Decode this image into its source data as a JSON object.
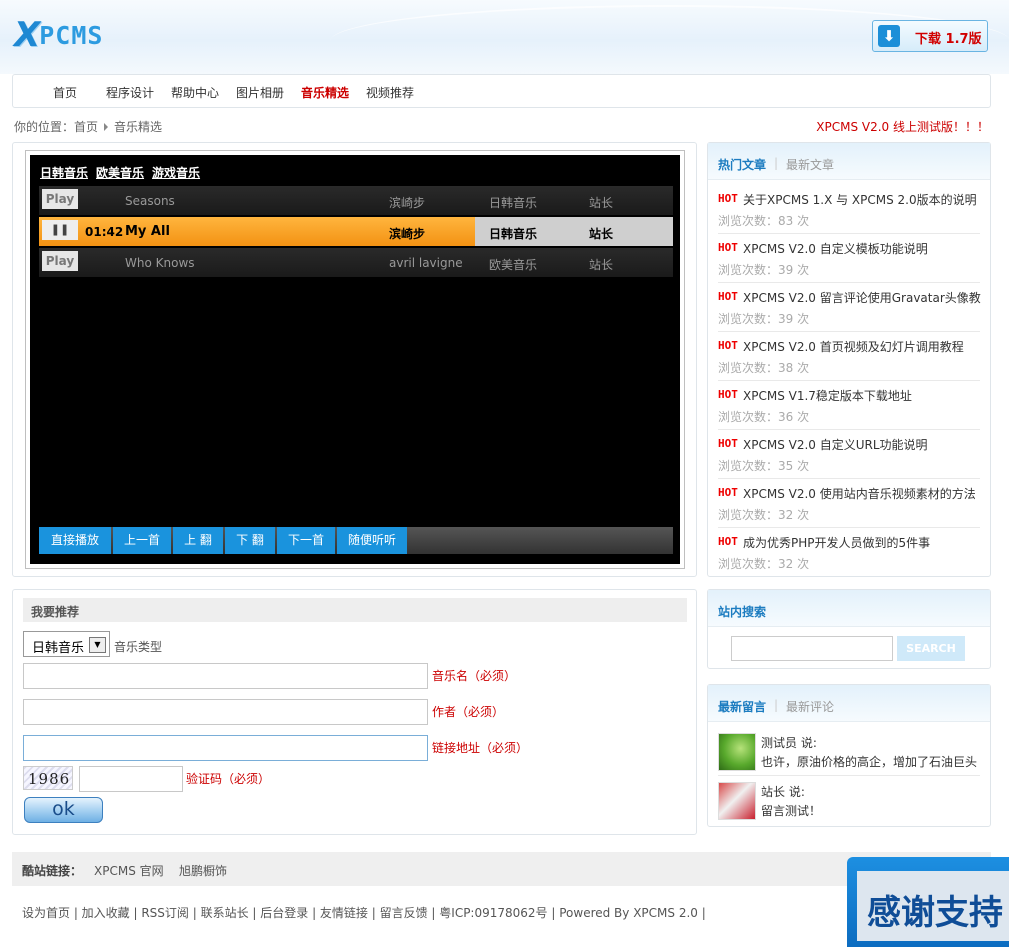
{
  "header": {
    "logo_x": "X",
    "logo_rest": "PCMS",
    "download_label": "下载 1.7版",
    "download_icon": "download-arrow-icon"
  },
  "nav": [
    "首页",
    "程序设计",
    "帮助中心",
    "图片相册",
    "音乐精选",
    "视频推荐"
  ],
  "nav_active": "音乐精选",
  "breadcrumb": {
    "prefix": "你的位置：",
    "home": "首页",
    "current": "音乐精选"
  },
  "notice": "XPCMS V2.0 线上测试版！！！",
  "player": {
    "tabs": [
      "日韩音乐",
      "欧美音乐",
      "游戏音乐"
    ],
    "play_label": "Play",
    "tracks": [
      {
        "title": "Seasons",
        "artist": "滨崎步",
        "category": "日韩音乐",
        "uploader": "站长",
        "state": "idle"
      },
      {
        "time": "01:42",
        "title": "My All",
        "artist": "滨崎步",
        "category": "日韩音乐",
        "uploader": "站长",
        "state": "playing"
      },
      {
        "title": "Who Knows",
        "artist": "avril lavigne",
        "category": "欧美音乐",
        "uploader": "站长",
        "state": "idle"
      }
    ],
    "controls": [
      "直接播放",
      "上一首",
      "上 翻",
      "下 翻",
      "下一首",
      "随便听听"
    ]
  },
  "hot": {
    "tab_active": "热门文章",
    "tab_other": "最新文章",
    "hot_tag": "HOT",
    "items": [
      {
        "title": "关于XPCMS 1.X 与 XPCMS 2.0版本的说明",
        "views": "浏览次数：83 次"
      },
      {
        "title": "XPCMS V2.0 自定义模板功能说明",
        "views": "浏览次数：39 次"
      },
      {
        "title": "XPCMS V2.0 留言评论使用Gravatar头像教",
        "views": "浏览次数：39 次"
      },
      {
        "title": "XPCMS V2.0 首页视频及幻灯片调用教程",
        "views": "浏览次数：38 次"
      },
      {
        "title": "XPCMS V1.7稳定版本下载地址",
        "views": "浏览次数：36 次"
      },
      {
        "title": "XPCMS V2.0 自定义URL功能说明",
        "views": "浏览次数：35 次"
      },
      {
        "title": "XPCMS V2.0 使用站内音乐视频素材的方法",
        "views": "浏览次数：32 次"
      },
      {
        "title": "成为优秀PHP开发人员做到的5件事",
        "views": "浏览次数：32 次"
      }
    ]
  },
  "search": {
    "title": "站内搜索",
    "button": "SEARCH",
    "value": ""
  },
  "comments": {
    "tab_active": "最新留言",
    "tab_other": "最新评论",
    "items": [
      {
        "who": "测试员 说:",
        "text": "也许，原油价格的高企，增加了石油巨头"
      },
      {
        "who": "站长 说:",
        "text": "留言测试！"
      }
    ]
  },
  "recommend": {
    "title": "我要推荐",
    "type_value": "日韩音乐",
    "type_label": "音乐类型",
    "name_label": "音乐名（必须）",
    "author_label": "作者（必须）",
    "url_label": "链接地址（必须）",
    "captcha_text": "1986",
    "captcha_label": "验证码（必须）",
    "ok_label": "ok"
  },
  "friend_links": {
    "label": "酷站链接：",
    "links": [
      "XPCMS 官网",
      "旭鹏橱饰"
    ]
  },
  "footer": "设为首页 | 加入收藏 | RSS订阅 | 联系站长 | 后台登录 | 友情链接 | 留言反馈 | 粤ICP:09178062号 | Powered By XPCMS 2.0 |",
  "thanks_banner": "感谢支持"
}
